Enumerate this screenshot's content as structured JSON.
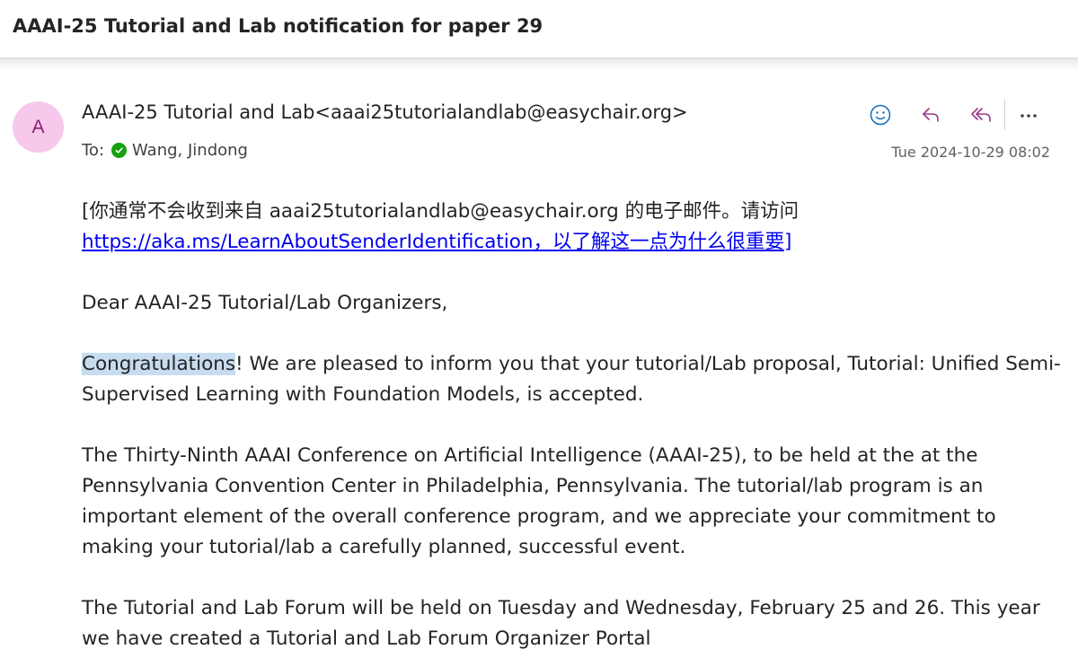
{
  "email": {
    "subject": "AAAI-25 Tutorial and Lab notification for paper 29",
    "sender": {
      "avatar_letter": "A",
      "display": "AAAI-25 Tutorial and Lab<aaai25tutorialandlab@easychair.org>"
    },
    "to_label": "To:",
    "recipient": "Wang, Jindong",
    "date": "Tue 2024-10-29 08:02",
    "actions": [
      {
        "name": "emoji-react",
        "icon": "smiley-icon"
      },
      {
        "name": "reply",
        "icon": "reply-icon"
      },
      {
        "name": "reply-all",
        "icon": "reply-all-icon"
      },
      {
        "name": "more",
        "icon": "more-icon"
      }
    ],
    "body": {
      "notice_prefix": "[你通常不会收到来自 aaai25tutorialandlab@easychair.org 的电子邮件。请访问",
      "notice_link": "https://aka.ms/LearnAboutSenderIdentification，以了解这一点为什么很重要]",
      "greeting": "Dear AAAI-25 Tutorial/Lab Organizers,",
      "congrats_highlight": "Congratulations",
      "congrats_rest": "! We are pleased to inform you that your tutorial/Lab proposal, Tutorial: Unified Semi-Supervised Learning with Foundation Models, is accepted.",
      "paragraph_conference": "The Thirty-Ninth AAAI Conference on Artificial Intelligence (AAAI-25), to be held at the at the Pennsylvania Convention Center in Philadelphia, Pennsylvania. The tutorial/lab program is an important element of the overall conference program, and we appreciate your commitment to making your tutorial/lab a carefully planned, successful event.",
      "paragraph_forum": "The Tutorial and Lab Forum will be held on Tuesday and Wednesday, February 25 and 26. This year we have created a Tutorial and Lab Forum Organizer Portal"
    }
  },
  "colors": {
    "avatar_bg": "#f7c8ec",
    "avatar_text": "#8a2072",
    "accent_purple": "#9b3a8a",
    "smiley_blue": "#0f6cbd",
    "verified_green": "#13a10e",
    "link": "#0000ee",
    "highlight": "#c7dcef"
  }
}
